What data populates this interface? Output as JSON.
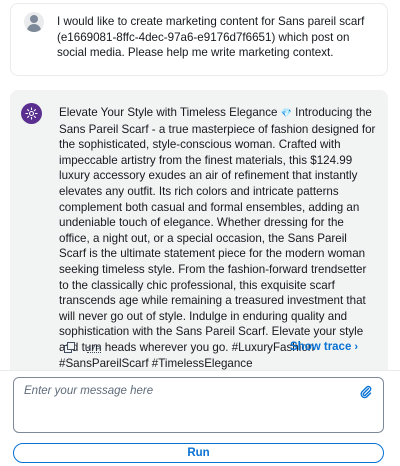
{
  "user_message": {
    "avatar_icon": "user-icon",
    "text": "I would like to create marketing content for Sans pareil scarf (e1669081-8ffc-4dec-97a6-e9176d7f6651) which post on social media. Please help me write marketing context."
  },
  "assistant_message": {
    "avatar_icon": "assistant-logo-icon",
    "text_before_emoji": "Elevate Your Style with Timeless Elegance ",
    "emoji": "💎",
    "text_after_emoji": " Introducing the Sans Pareil Scarf - a true masterpiece of fashion designed for the sophisticated, style-conscious woman. Crafted with impeccable artistry from the finest materials, this $124.99 luxury accessory exudes an air of refinement that instantly elevates any outfit. Its rich colors and intricate patterns complement both casual and formal ensembles, adding an undeniable touch of elegance. Whether dressing for the office, a night out, or a special occasion, the Sans Pareil Scarf is the ultimate statement piece for the modern woman seeking timeless style. From the fashion-forward trendsetter to the classically chic professional, this exquisite scarf transcends age while remaining a treasured investment that will never go out of style. Indulge in enduring quality and sophistication with the Sans Pareil Scarf. Elevate your style and turn heads wherever you go. #LuxuryFashion #SansPareilScarf #TimelessElegance",
    "actions": {
      "copy_icon": "copy-icon",
      "code_icon": "code-icon",
      "code_icon_glyph": "</>",
      "show_trace_label": "Show trace",
      "show_trace_chevron": "›"
    }
  },
  "composer": {
    "placeholder": "Enter your message here",
    "value": "",
    "attach_icon": "paperclip-icon",
    "run_label": "Run"
  },
  "colors": {
    "accent": "#0972d3",
    "assistant_bubble": "#f2f3f3",
    "assistant_avatar": "#5a2f8f"
  }
}
